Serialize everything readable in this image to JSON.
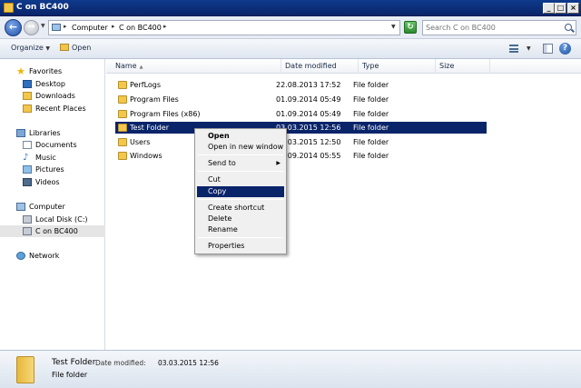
{
  "window": {
    "title": "C on BC400"
  },
  "address": {
    "crumbs": [
      "Computer",
      "C on BC400"
    ],
    "separator": "▸"
  },
  "search": {
    "placeholder": "Search C on BC400"
  },
  "toolbar": {
    "organize_label": "Organize",
    "open_label": "Open"
  },
  "sidebar": {
    "favorites": "Favorites",
    "favorite_items": [
      "Desktop",
      "Downloads",
      "Recent Places"
    ],
    "libraries": "Libraries",
    "library_items": [
      "Documents",
      "Music",
      "Pictures",
      "Videos"
    ],
    "computer": "Computer",
    "computer_items": [
      "Local Disk (C:)",
      "C on BC400"
    ],
    "network": "Network"
  },
  "columns": {
    "name": "Name",
    "date": "Date modified",
    "type": "Type",
    "size": "Size"
  },
  "files": [
    {
      "name": "PerfLogs",
      "date": "22.08.2013 17:52",
      "type": "File folder"
    },
    {
      "name": "Program Files",
      "date": "01.09.2014 05:49",
      "type": "File folder"
    },
    {
      "name": "Program Files (x86)",
      "date": "01.09.2014 05:49",
      "type": "File folder"
    },
    {
      "name": "Test Folder",
      "date": "03.03.2015 12:56",
      "type": "File folder"
    },
    {
      "name": "Users",
      "date": "03.03.2015 12:50",
      "type": "File folder"
    },
    {
      "name": "Windows",
      "date": "01.09.2014 05:55",
      "type": "File folder"
    }
  ],
  "context_menu": {
    "open": "Open",
    "open_new_window": "Open in new window",
    "send_to": "Send to",
    "cut": "Cut",
    "copy": "Copy",
    "create_shortcut": "Create shortcut",
    "delete": "Delete",
    "rename": "Rename",
    "properties": "Properties"
  },
  "details": {
    "name": "Test Folder",
    "modified_label": "Date modified:",
    "modified_value": "03.03.2015 12:56",
    "type": "File folder"
  },
  "colors": {
    "selection": "#0a246a",
    "titlebar": "#0a246a"
  }
}
